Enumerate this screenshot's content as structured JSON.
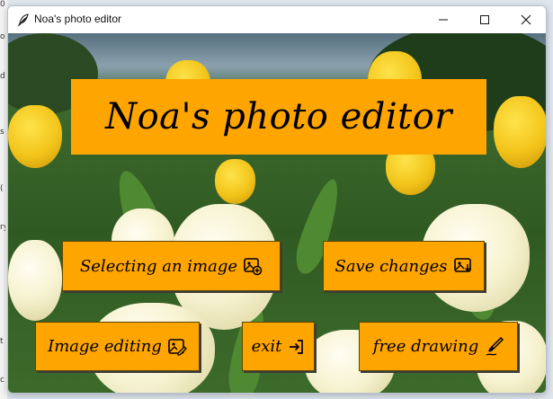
{
  "window": {
    "title": "Noa's photo editor",
    "app_icon": "feather-icon",
    "controls": [
      "minimize-icon",
      "maximize-icon",
      "close-icon"
    ]
  },
  "background_strip": {
    "fragments": [
      "0.",
      "o",
      "d",
      "s",
      "(",
      "ry",
      "t",
      "c"
    ]
  },
  "banner": {
    "title": "Noa's photo editor"
  },
  "buttons": {
    "select_image": {
      "label": "Selecting an image",
      "icon": "add-image-icon"
    },
    "save_changes": {
      "label": "Save changes",
      "icon": "save-image-icon"
    },
    "image_editing": {
      "label": "Image editing",
      "icon": "edit-image-icon"
    },
    "exit": {
      "label": "exit",
      "icon": "exit-icon"
    },
    "free_drawing": {
      "label": "free drawing",
      "icon": "paintbrush-icon"
    }
  },
  "colors": {
    "accent": "#ffa500",
    "text": "#000000"
  }
}
